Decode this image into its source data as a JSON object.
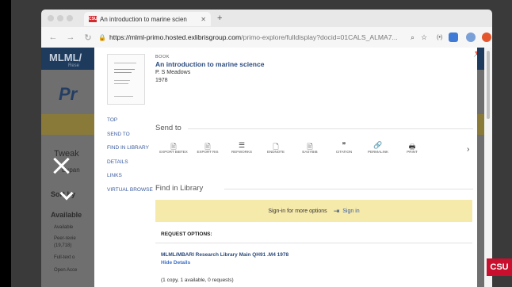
{
  "browser": {
    "tab_title": "An introduction to marine scien",
    "tab_favicon": "CSU",
    "url_host": "https://mlml-primo.hosted.exlibrisgroup.com",
    "url_path": "/primo-explore/fulldisplay?docid=01CALS_ALMA7..."
  },
  "backdrop": {
    "logo": "MLML/",
    "logo_sub": "Rese",
    "tweak": "Tweak",
    "expand": "Expan",
    "sort_by": "Sort by",
    "available": "Available",
    "filters": [
      "Available",
      "Peer-revie",
      "(19,718)",
      "Full-text o",
      "Open Acce"
    ]
  },
  "record": {
    "type": "BOOK",
    "title": "An introduction to marine science",
    "author": "P. S Meadows",
    "year": "1978"
  },
  "nav": [
    "TOP",
    "SEND TO",
    "FIND IN LIBRARY",
    "DETAILS",
    "LINKS",
    "VIRTUAL BROWSE"
  ],
  "send_to": {
    "heading": "Send to",
    "actions": [
      {
        "icon": "export-bibtex-icon",
        "label": "EXPORT BIBTEX"
      },
      {
        "icon": "export-ris-icon",
        "label": "EXPORT RIS"
      },
      {
        "icon": "refworks-icon",
        "label": "REFWORKS"
      },
      {
        "icon": "endnote-icon",
        "label": "ENDNOTE"
      },
      {
        "icon": "easybib-icon",
        "label": "EASYBIB"
      },
      {
        "icon": "citation-icon",
        "label": "CITATION"
      },
      {
        "icon": "permalink-icon",
        "label": "PERMALINK"
      },
      {
        "icon": "print-icon",
        "label": "PRINT"
      }
    ]
  },
  "find_in_library": {
    "heading": "Find in Library",
    "signin_text": "Sign-in for more options",
    "signin_link": "Sign in",
    "request_options": "REQUEST OPTIONS:",
    "holding": "MLML/MBARI Research Library  Main  QH91 .M4 1978",
    "hide_details": "Hide Details",
    "availability": "(1 copy, 1 available, 0 requests)"
  },
  "badge": "CSU"
}
